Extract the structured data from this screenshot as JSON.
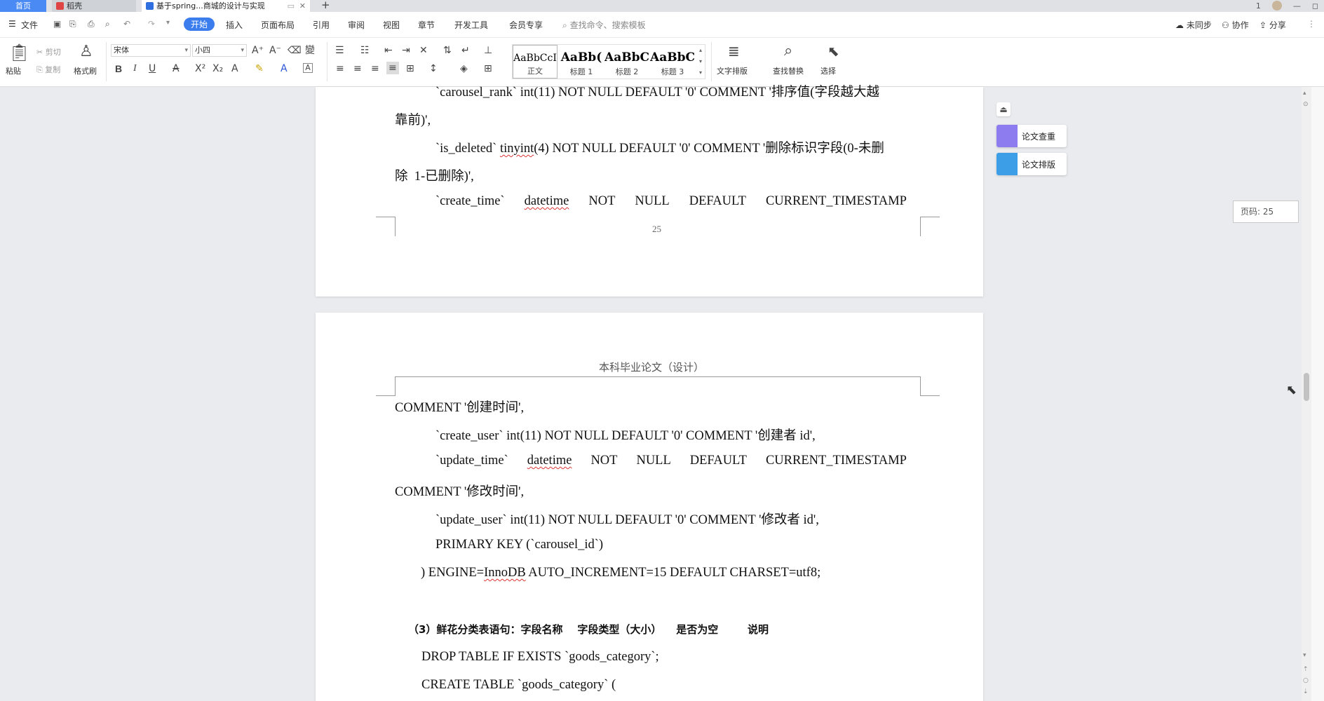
{
  "tabs": {
    "home": "首页",
    "daoke": "稻壳",
    "doc": "基于spring...商城的设计与实现",
    "plus": "+"
  },
  "window_controls": [
    "1",
    "—",
    "◻"
  ],
  "menu": {
    "file": "文件",
    "items": [
      "开始",
      "插入",
      "页面布局",
      "引用",
      "审阅",
      "视图",
      "章节",
      "开发工具",
      "会员专享"
    ],
    "search_placeholder": "查找命令、搜索模板",
    "right": [
      "未同步",
      "协作",
      "分享"
    ]
  },
  "ribbon": {
    "paste": "粘贴",
    "cut": "剪切",
    "copy": "复制",
    "format_painter": "格式刷",
    "font_name": "宋体",
    "font_size": "小四",
    "styles": [
      {
        "preview": "AaBbCcI",
        "label": "正文"
      },
      {
        "preview": "AaBb(",
        "label": "标题 1"
      },
      {
        "preview": "AaBbC",
        "label": "标题 2"
      },
      {
        "preview": "AaBbC",
        "label": "标题 3"
      }
    ],
    "text_layout": "文字排版",
    "find_replace": "查找替换",
    "select": "选择"
  },
  "page1": {
    "lines": [
      [
        "`carousel_rank` int(11) NOT NULL DEFAULT '0' COMMENT '排序值(字段越大越"
      ],
      [
        "靠前)',"
      ],
      [
        "`is_deleted` ",
        "tinyint",
        "(4) NOT NULL DEFAULT '0' COMMENT '删除标识字段(0-未删"
      ],
      [
        "除  1-已删除)',"
      ],
      [
        "`create_time`",
        "datetime",
        "NOT",
        "NULL",
        "DEFAULT",
        "CURRENT_TIMESTAMP"
      ]
    ],
    "page_number": "25"
  },
  "page2": {
    "header": "本科毕业论文（设计）",
    "lines": [
      "COMMENT '创建时间',",
      "`create_user` int(11) NOT NULL DEFAULT '0' COMMENT '创建者 id',",
      [
        "`update_time`",
        "datetime",
        "NOT",
        "NULL",
        "DEFAULT",
        "CURRENT_TIMESTAMP"
      ],
      "COMMENT '修改时间',",
      "`update_user` int(11) NOT NULL DEFAULT '0' COMMENT '修改者 id',",
      "PRIMARY KEY (`carousel_id`)",
      [
        ") ENGINE=",
        "InnoDB",
        " AUTO_INCREMENT=15 DEFAULT CHARSET=utf8;"
      ],
      "（3）鲜花分类表语句：字段名称    字段类型（大小）    是否为空        说明",
      "DROP TABLE IF EXISTS `goods_category`;",
      "CREATE TABLE `goods_category` ("
    ]
  },
  "side_panel": {
    "check": "论文查重",
    "layout": "论文排版",
    "collapse_icon": "chevron-up-icon"
  },
  "page_badge": "页码: 25"
}
